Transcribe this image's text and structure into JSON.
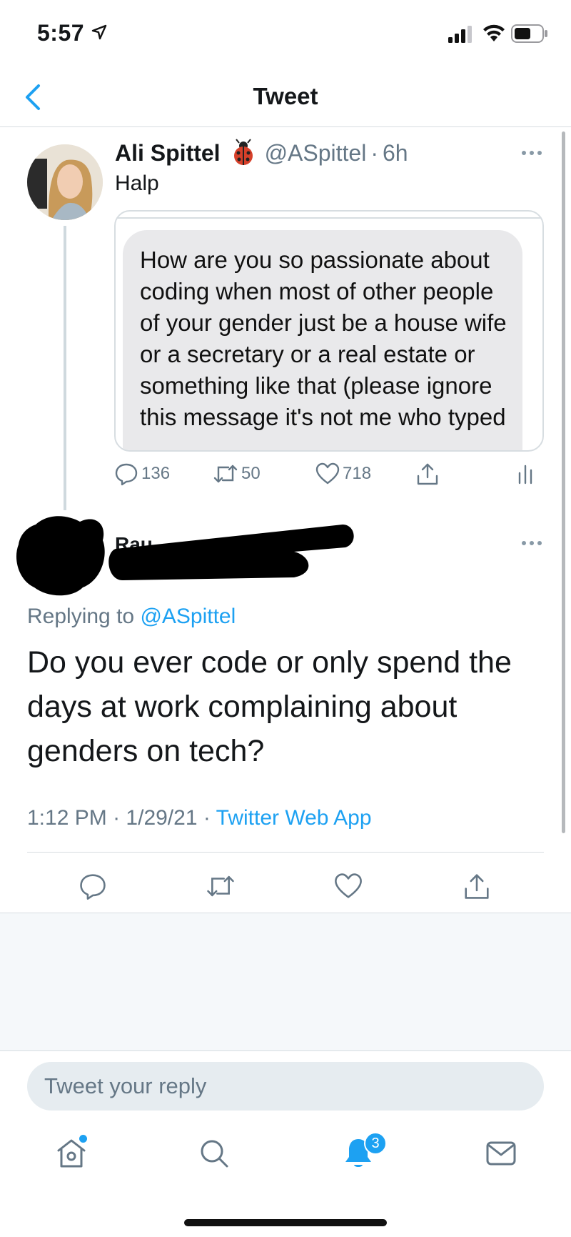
{
  "status_bar": {
    "time": "5:57"
  },
  "nav": {
    "title": "Tweet"
  },
  "original_tweet": {
    "name": "Ali Spittel",
    "handle": "@ASpittel",
    "separator": "·",
    "age": "6h",
    "text": "Halp",
    "media_message": "How are you so passionate about coding when most of other people of your gender just be a house wife or a secretary or a real estate or something like that (please ignore this message it's not me who typed",
    "replies": "136",
    "retweets": "50",
    "likes": "718"
  },
  "reply_tweet": {
    "name_fragment": "Rau",
    "replying_prefix": "Replying to",
    "replying_handle": "@ASpittel",
    "text": "Do you ever code or only spend the days at work complaining about genders on tech?",
    "time": "1:12 PM",
    "separator": "·",
    "date": "1/29/21",
    "source": "Twitter Web App"
  },
  "composer": {
    "placeholder": "Tweet your reply"
  },
  "tab_bar": {
    "notification_count": "3"
  },
  "colors": {
    "accent": "#1da1f2",
    "secondary_text": "#657786",
    "divider": "#d7dde1"
  }
}
